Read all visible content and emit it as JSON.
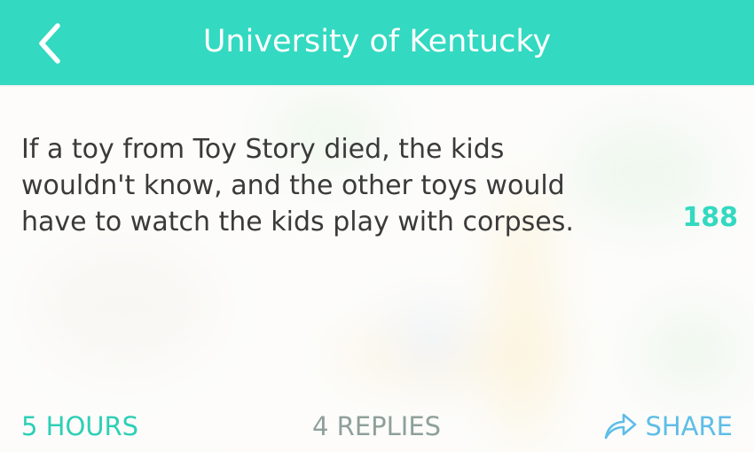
{
  "header": {
    "title": "University of Kentucky",
    "back_icon": "chevron-left-icon",
    "background_color": "#33d9c1"
  },
  "post": {
    "text": "If a toy from Toy Story died, the kids wouldn't know, and the other toys would have to watch the kids play with corpses.",
    "votes": "188",
    "vote_color": "#33d9c1"
  },
  "footer": {
    "time": "5 HOURS",
    "replies": "4 REPLIES",
    "share": "SHARE",
    "share_icon": "share-arrow-icon",
    "time_color": "#2ecfb6",
    "replies_color": "#8fa09c",
    "share_color": "#5fbde8"
  }
}
